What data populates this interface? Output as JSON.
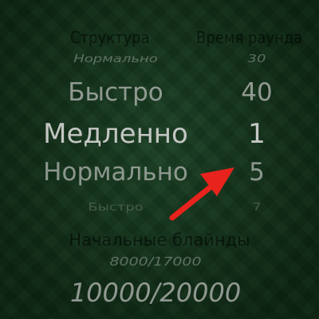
{
  "headers": {
    "structure": "Структура",
    "round_time": "Время раунда"
  },
  "structure_picker": {
    "items": [
      "Нормально",
      "Быстро",
      "Медленно",
      "Нормально",
      "Быстро"
    ],
    "selected": "Медленно"
  },
  "round_time_picker": {
    "items": [
      "30",
      "40",
      "1",
      "5",
      "7"
    ],
    "selected": "1"
  },
  "blinds": {
    "title": "Начальные блайнды",
    "previous": "8000/17000",
    "current": "10000/20000"
  },
  "colors": {
    "background": "#163d1f",
    "text": "#b9bcb9",
    "arrow": "#e8231d"
  }
}
